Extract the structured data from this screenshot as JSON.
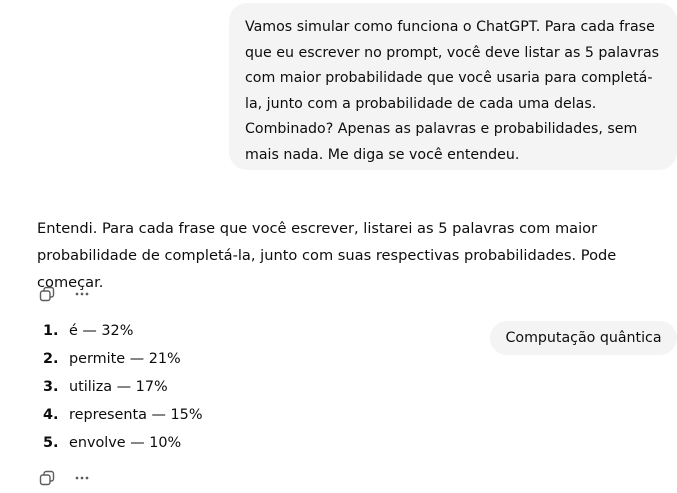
{
  "user_message": {
    "lines": [
      "Vamos simular como funciona o ChatGPT. Para cada frase",
      "que eu escrever no prompt, você deve listar as 5 palavras",
      "com maior probabilidade que você usaria para completá-",
      "la, junto com a probabilidade de cada uma delas.",
      "Combinado? Apenas as palavras e probabilidades, sem",
      "mais nada. Me diga se você entendeu."
    ]
  },
  "assistant_reply": {
    "text": "Entendi. Para cada frase que você escrever, listarei as 5 palavras com maior probabilidade de completá-la, junto com suas respectivas probabilidades. Pode começar."
  },
  "user_message_2": {
    "text": "Computação quântica"
  },
  "assistant_list": {
    "items": [
      {
        "num": "1.",
        "text": "é — 32%"
      },
      {
        "num": "2.",
        "text": "permite — 21%"
      },
      {
        "num": "3.",
        "text": "utiliza — 17%"
      },
      {
        "num": "4.",
        "text": "representa — 15%"
      },
      {
        "num": "5.",
        "text": "envolve — 10%"
      }
    ]
  },
  "icons": {
    "copy": "copy-icon",
    "more": "more-options-icon"
  }
}
